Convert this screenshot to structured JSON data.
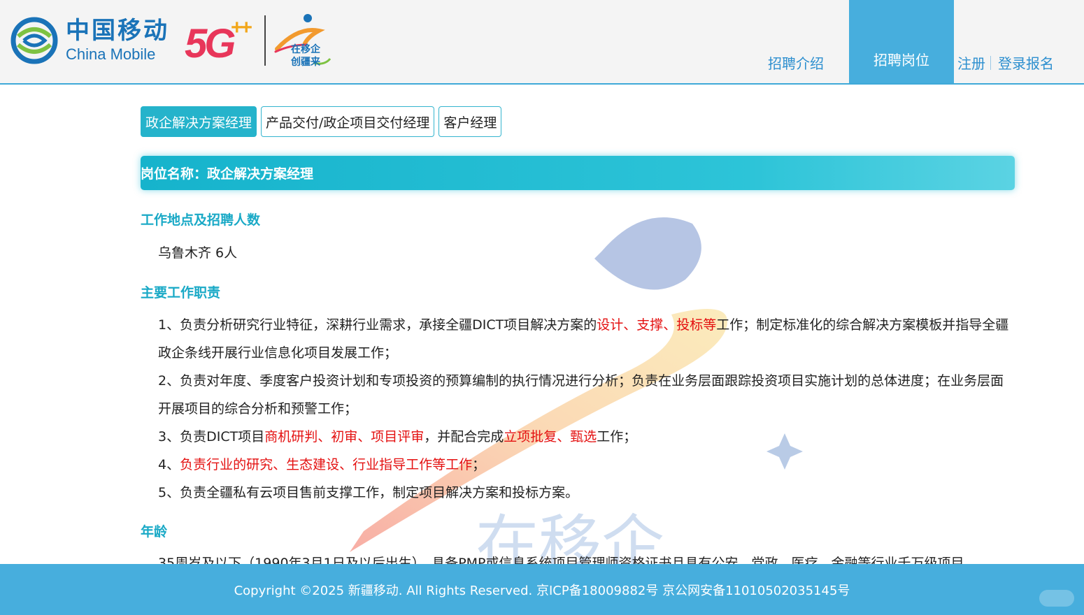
{
  "header": {
    "brand_cn": "中国移动",
    "brand_en": "China Mobile",
    "badge_5g": "5G",
    "badge_plus": "++",
    "slogan_line1": "在移企",
    "slogan_line2": "创疆来",
    "nav": {
      "intro": "招聘介绍",
      "jobs": "招聘岗位",
      "register": "注册",
      "login": "登录报名"
    }
  },
  "tabs": [
    {
      "label": "政企解决方案经理",
      "active": true
    },
    {
      "label": "产品交付/政企项目交付经理",
      "active": false
    },
    {
      "label": "客户经理",
      "active": false
    }
  ],
  "position_title": "岗位名称：政企解决方案经理",
  "sections": {
    "location_heading": "工作地点及招聘人数",
    "location_value": "乌鲁木齐 6人",
    "duties_heading": "主要工作职责",
    "age_heading": "年龄"
  },
  "duties": {
    "d1": {
      "a": "1、负责分析研究行业特征，深耕行业需求，承接全疆DICT项目解决方案的",
      "red": "设计、支撑、投标等",
      "b": "工作；制定标准化的综合解决方案模板并指导全疆政企条线开展行业信息化项目发展工作；"
    },
    "d2": "2、负责对年度、季度客户投资计划和专项投资的预算编制的执行情况进行分析；负责在业务层面跟踪投资项目实施计划的总体进度；在业务层面开展项目的综合分析和预警工作；",
    "d3": {
      "a": "3、负责DICT项目",
      "red1": "商机研判、初审、项目评审",
      "b": "，并配合完成",
      "red2": "立项批复、甄选",
      "c": "工作；"
    },
    "d4": {
      "a": "4、",
      "red": "负责行业的研究、生态建设、行业指导工作等工作",
      "b": "；"
    },
    "d5": "5、负责全疆私有云项目售前支撑工作，制定项目解决方案和投标方案。"
  },
  "age_text_partial": "35周岁及以下（1990年3月1日及以后出生），具备PMP或信息系统项目管理师资格证书且具有公安、党政、医疗、金融等行业千万级项目",
  "footer": "Copyright ©2025 新疆移动. All Rights Reserved. 京ICP备18009882号 京公网安备11010502035145号",
  "colors": {
    "accent": "#47aedd",
    "tab_active": "#25b3cb",
    "heading": "#19a9c6",
    "highlight_red": "#e41010",
    "brand_blue": "#1a73b8"
  }
}
